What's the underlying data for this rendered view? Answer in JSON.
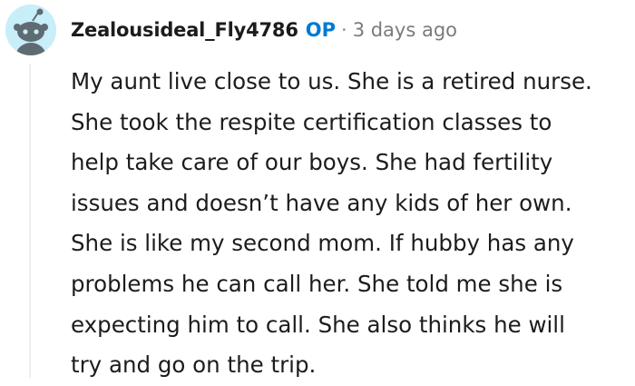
{
  "comment": {
    "author": "Zealousideal_Fly4786",
    "op_badge": "OP",
    "separator": "·",
    "timestamp": "3 days ago",
    "avatar_icon": "snoo-avatar-icon",
    "body_lines": [
      "My aunt live close to us. She is a retired nurse.",
      "She took the respite certification classes to",
      "help take care of our boys. She had fertility",
      "issues and doesn’t have any kids of her own.",
      "She is like my second mom. If hubby has any",
      "problems he can call her. She told me she is",
      "expecting him to call. She also thinks he will",
      "try and go on the trip."
    ]
  },
  "colors": {
    "op_badge": "#0079d3",
    "avatar_bg": "#c7eef9",
    "text": "#1c1c1c",
    "meta": "#787c7e"
  }
}
